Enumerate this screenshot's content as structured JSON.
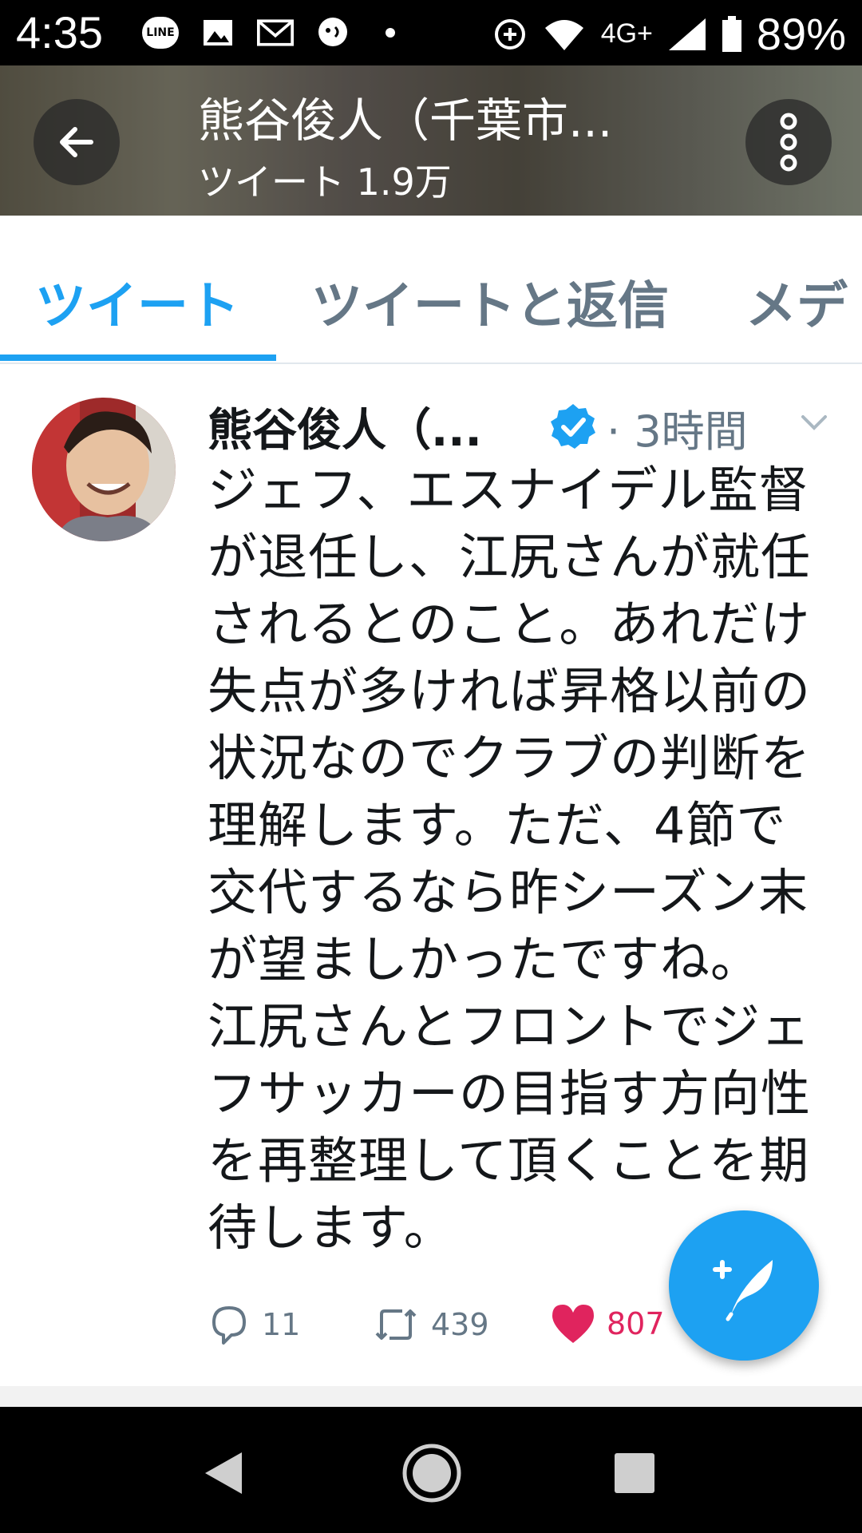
{
  "status_bar": {
    "time": "4:35",
    "line_label": "LINE",
    "network": "4G+",
    "battery": "89%",
    "icons": [
      "line-icon",
      "image-icon",
      "gmail-icon",
      "message-icon",
      "dot-icon",
      "data-saver-icon",
      "wifi-icon",
      "signal-icon",
      "battery-icon"
    ]
  },
  "header": {
    "title": "熊谷俊人（千葉市...",
    "subtitle": "ツイート 1.9万"
  },
  "tabs": [
    {
      "label": "ツイート",
      "active": true
    },
    {
      "label": "ツイートと返信",
      "active": false
    },
    {
      "label": "メデ",
      "active": false
    }
  ],
  "tweet": {
    "author": "熊谷俊人（...",
    "verified": true,
    "time": "· 3時間",
    "text": "ジェフ、エスナイデル監督\nが退任し、江尻さんが就任\nされるとのこと。あれだけ\n失点が多ければ昇格以前の\n状況なのでクラブの判断を\n理解します。ただ、4節で\n交代するなら昨シーズン末\nが望ましかったですね。\n江尻さんとフロントでジェ\nフサッカーの目指す方向性\nを再整理して頂くことを期\n待します。",
    "replies": "11",
    "retweets": "439",
    "likes": "807"
  },
  "colors": {
    "accent": "#1da1f2",
    "like": "#e0245e",
    "muted": "#657786"
  }
}
